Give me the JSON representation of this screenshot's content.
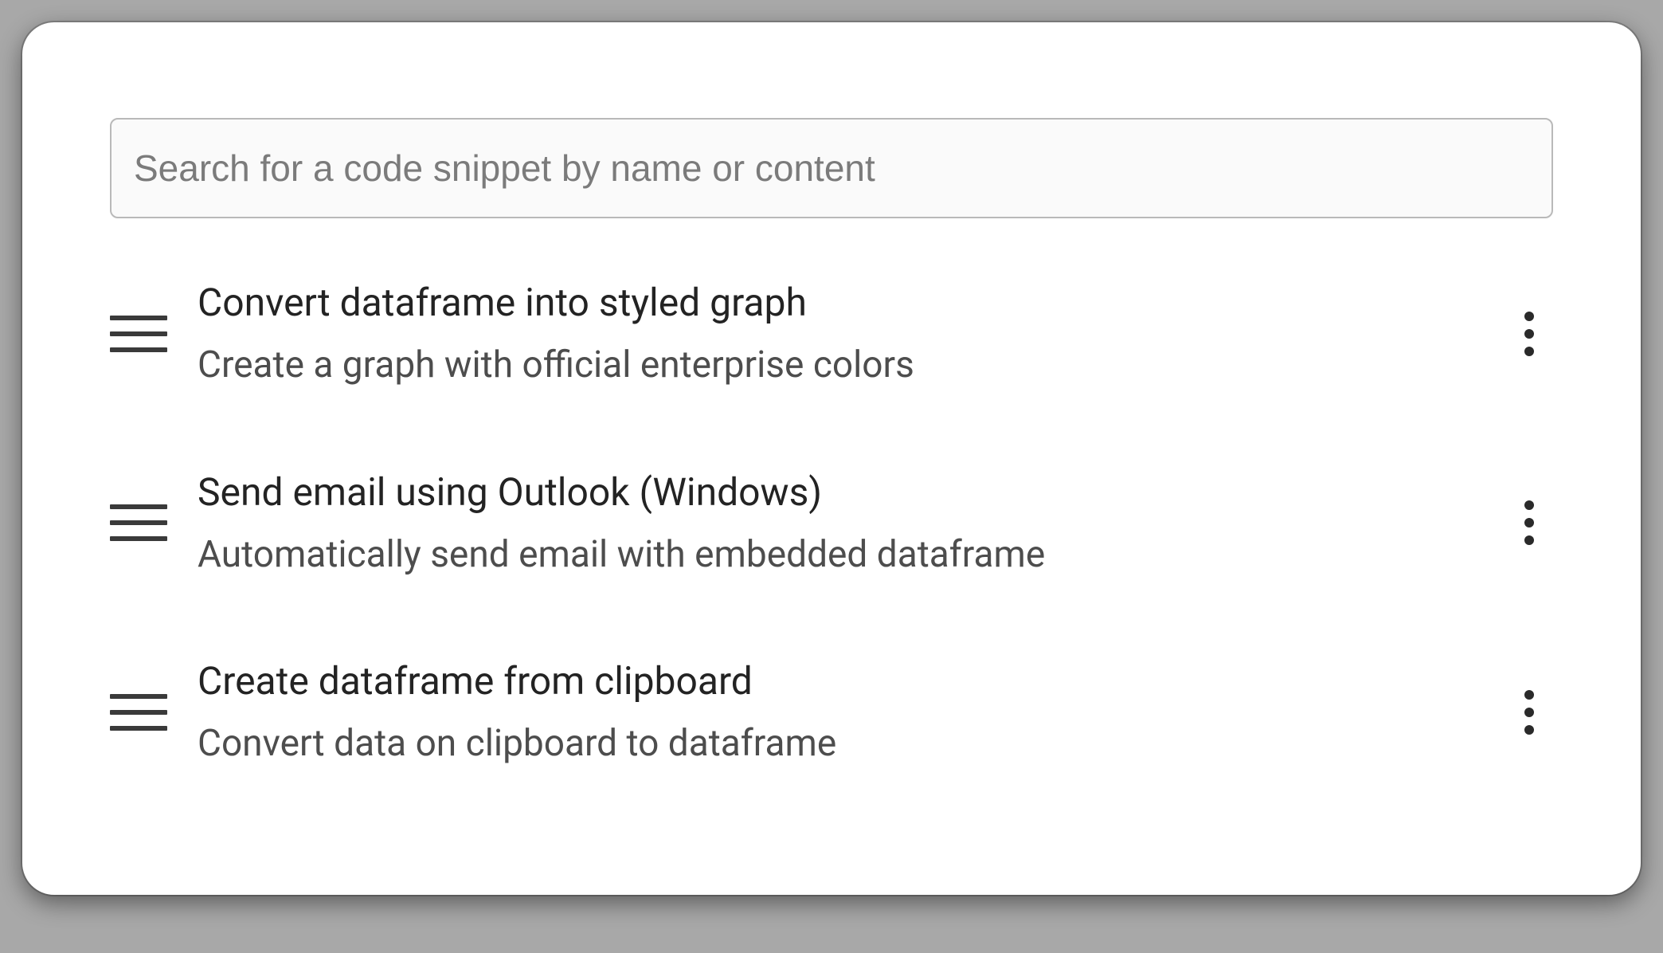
{
  "search": {
    "placeholder": "Search for a code snippet by name or content",
    "value": ""
  },
  "snippets": [
    {
      "title": "Convert dataframe into styled graph",
      "description": "Create a graph with official enterprise colors"
    },
    {
      "title": "Send email using Outlook (Windows)",
      "description": "Automatically send email with embedded dataframe"
    },
    {
      "title": "Create dataframe from clipboard",
      "description": "Convert data on clipboard to dataframe"
    }
  ]
}
